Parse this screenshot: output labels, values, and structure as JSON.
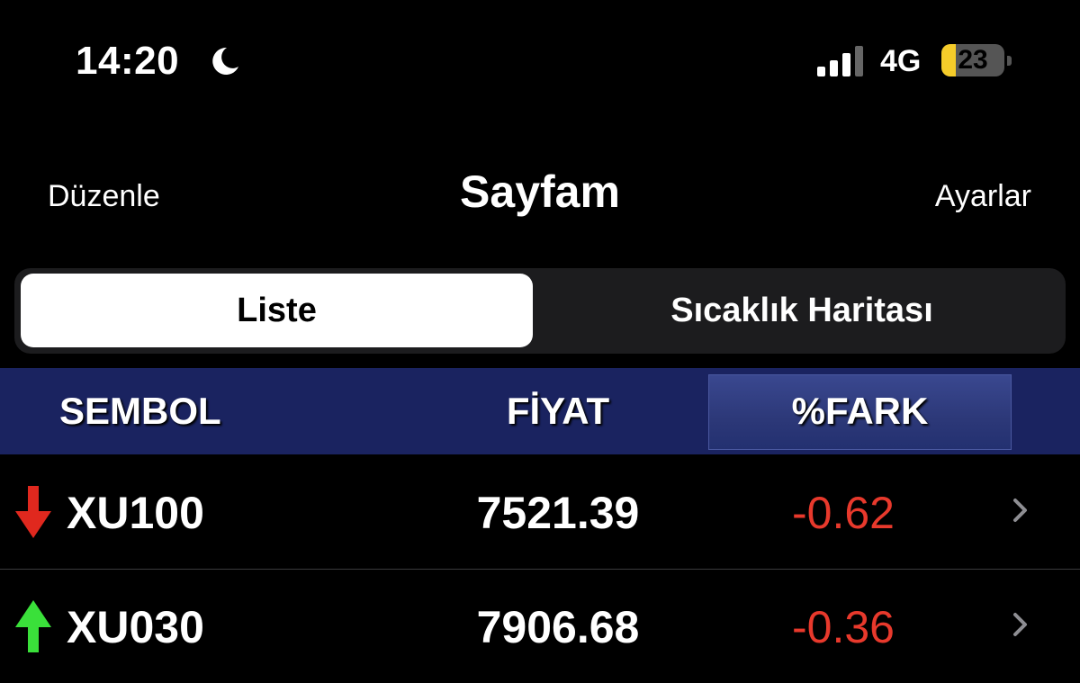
{
  "status_bar": {
    "time": "14:20",
    "network": "4G",
    "battery": "23",
    "battery_level_percent": 23,
    "icons": [
      "moon-icon",
      "signal-icon",
      "battery-icon"
    ]
  },
  "nav": {
    "left_label": "Düzenle",
    "title": "Sayfam",
    "right_label": "Ayarlar"
  },
  "segmented": {
    "tabs": [
      {
        "label": "Liste",
        "active": true
      },
      {
        "label": "Sıcaklık Haritası",
        "active": false
      }
    ]
  },
  "table": {
    "headers": {
      "symbol": "SEMBOL",
      "price": "FİYAT",
      "change": "%FARK"
    },
    "rows": [
      {
        "symbol": "XU100",
        "price": "7521.39",
        "change": "-0.62",
        "direction": "down",
        "icon": "arrow-down-icon"
      },
      {
        "symbol": "XU030",
        "price": "7906.68",
        "change": "-0.36",
        "direction": "up",
        "icon": "arrow-up-icon"
      }
    ]
  },
  "colors": {
    "background": "#000000",
    "header_bg": "#1a2360",
    "header_active_bg": "#2c3878",
    "negative": "#e8392c",
    "arrow_down": "#e0281e",
    "arrow_up": "#3ae03a",
    "battery_fill": "#f5cc2a"
  }
}
